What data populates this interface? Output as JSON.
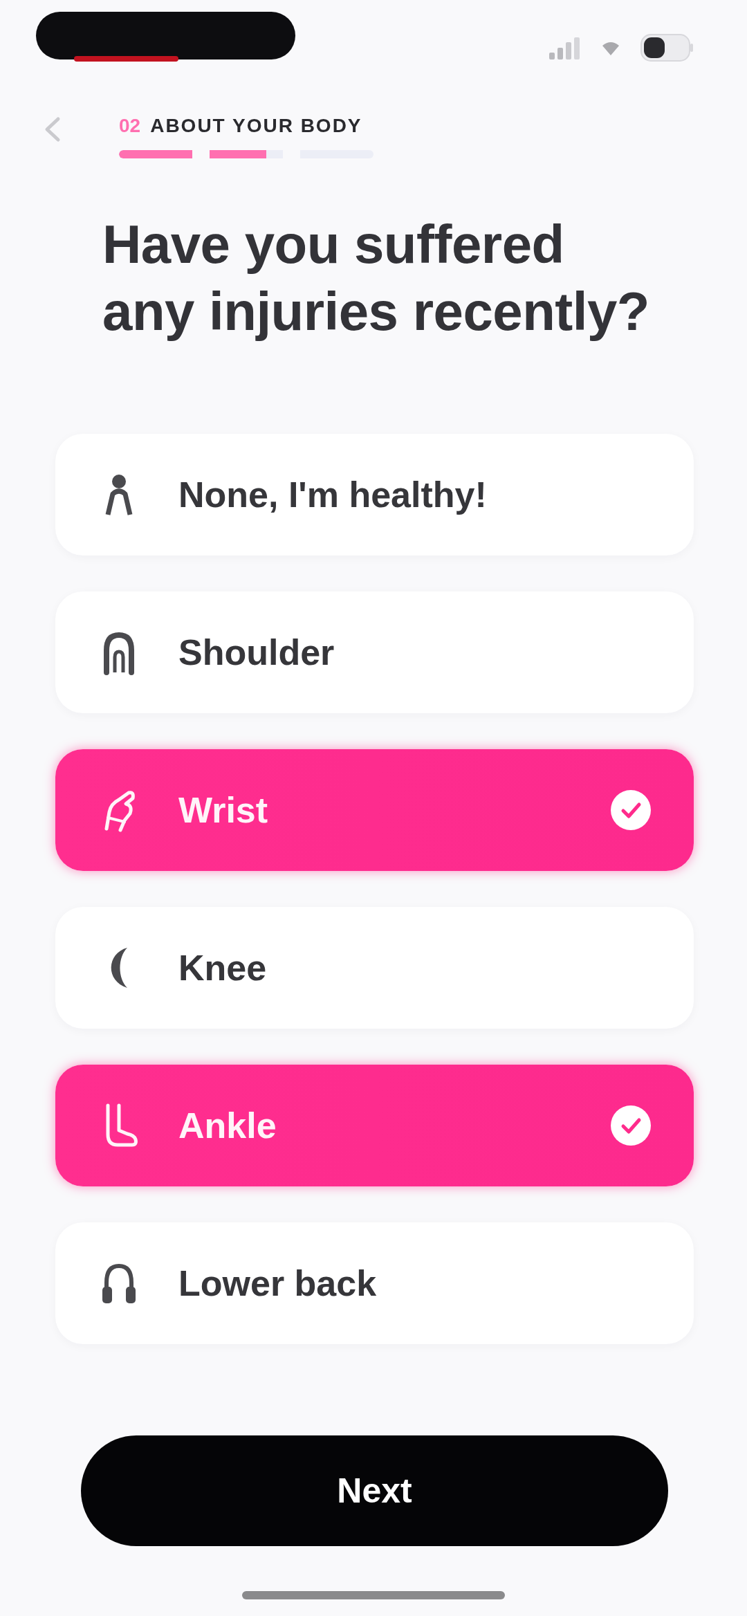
{
  "header": {
    "step_number": "02",
    "step_title": "ABOUT YOUR BODY",
    "progress": {
      "level": 0.58
    }
  },
  "question": {
    "lines": [
      "Have you suffered",
      "any injuries recently?"
    ]
  },
  "options": [
    {
      "label": "None, I'm healthy!",
      "selected": false
    },
    {
      "label": "Shoulder",
      "selected": false
    },
    {
      "label": "Wrist",
      "selected": true
    },
    {
      "label": "Knee",
      "selected": false
    },
    {
      "label": "Ankle",
      "selected": true
    },
    {
      "label": "Lower back",
      "selected": false
    }
  ],
  "next_button": {
    "label": "Next"
  }
}
